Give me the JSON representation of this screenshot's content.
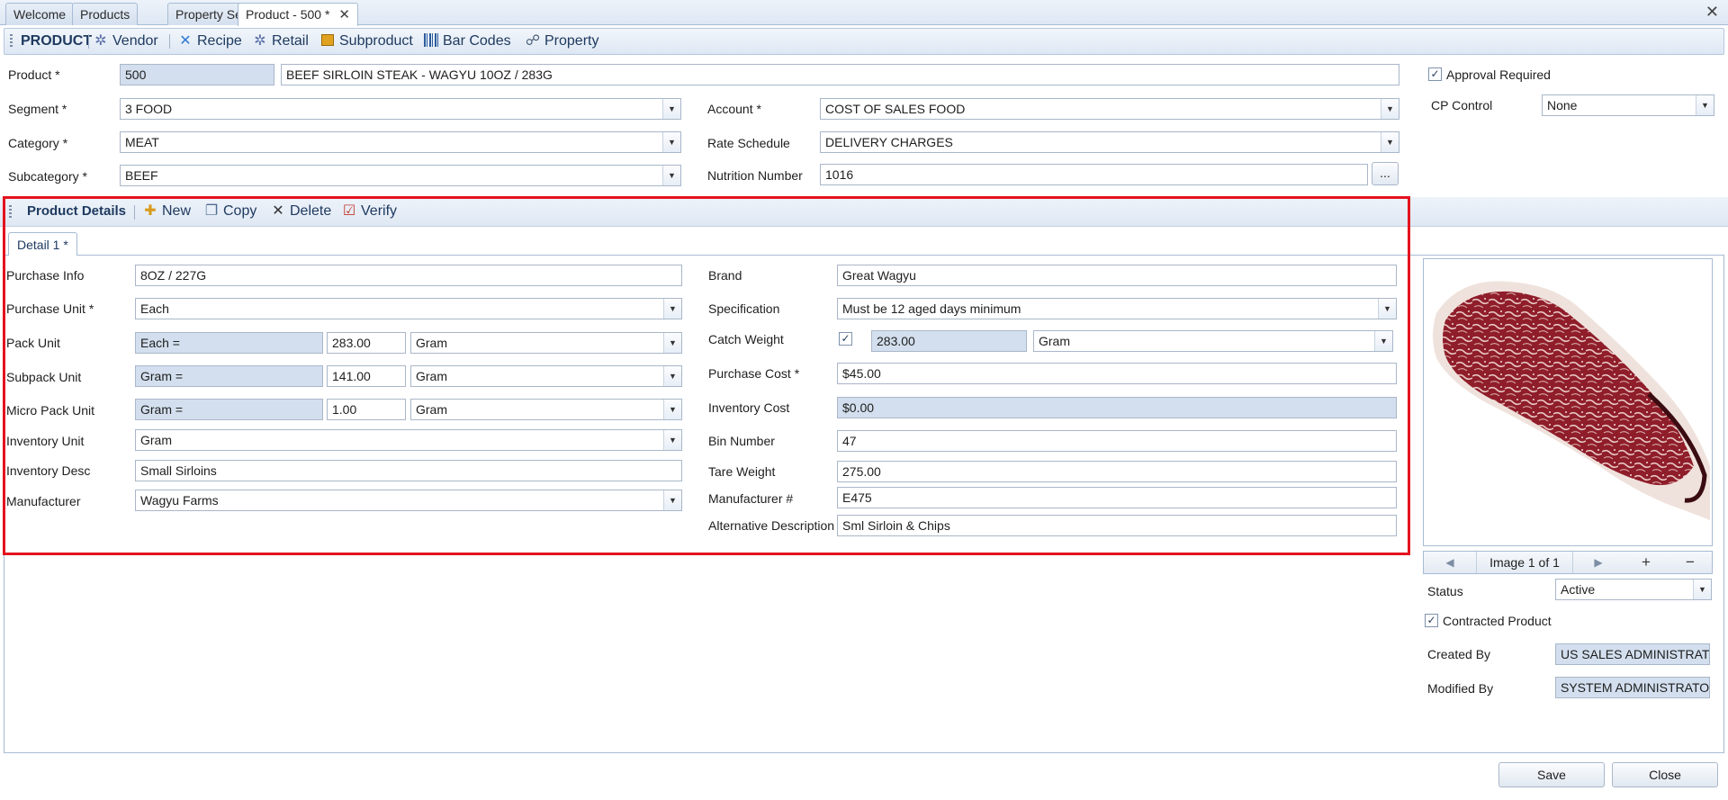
{
  "tabs": [
    {
      "label": "Welcome",
      "active": false
    },
    {
      "label": "Products",
      "active": false
    },
    {
      "label": "Property Setup",
      "active": false
    },
    {
      "label": "Product - 500 *",
      "active": true
    }
  ],
  "window_close": "✕",
  "toolbar": {
    "title": "PRODUCT",
    "vendor": "Vendor",
    "recipe": "Recipe",
    "retail": "Retail",
    "subproduct": "Subproduct",
    "barcodes": "Bar Codes",
    "property": "Property"
  },
  "header": {
    "product_label": "Product *",
    "product_code": "500",
    "product_name": "BEEF SIRLOIN STEAK - WAGYU 10OZ / 283G",
    "approval_label": "Approval Required",
    "approval_checked": true,
    "segment_label": "Segment *",
    "segment_value": "3 FOOD",
    "category_label": "Category *",
    "category_value": "MEAT",
    "subcategory_label": "Subcategory *",
    "subcategory_value": "BEEF",
    "account_label": "Account *",
    "account_value": "COST OF SALES FOOD",
    "rate_label": "Rate Schedule",
    "rate_value": "DELIVERY CHARGES",
    "nutrition_label": "Nutrition Number",
    "nutrition_value": "1016",
    "nutrition_btn": "...",
    "cp_label": "CP Control",
    "cp_value": "None"
  },
  "details_toolbar": {
    "title": "Product Details",
    "new": "New",
    "copy": "Copy",
    "delete": "Delete",
    "verify": "Verify"
  },
  "detail_tab": "Detail 1 *",
  "left_fields": {
    "purchase_info_label": "Purchase Info",
    "purchase_info_value": "8OZ / 227G",
    "purchase_unit_label": "Purchase Unit *",
    "purchase_unit_value": "Each",
    "pack_unit_label": "Pack Unit",
    "pack_unit_eq": "Each =",
    "pack_unit_qty": "283.00",
    "pack_unit_uom": "Gram",
    "subpack_label": "Subpack Unit",
    "subpack_eq": "Gram =",
    "subpack_qty": "141.00",
    "subpack_uom": "Gram",
    "micro_label": "Micro Pack Unit",
    "micro_eq": "Gram =",
    "micro_qty": "1.00",
    "micro_uom": "Gram",
    "inventory_unit_label": "Inventory Unit",
    "inventory_unit_value": "Gram",
    "inventory_desc_label": "Inventory Desc",
    "inventory_desc_value": "Small Sirloins",
    "manufacturer_label": "Manufacturer",
    "manufacturer_value": "Wagyu Farms"
  },
  "right_fields": {
    "brand_label": "Brand",
    "brand_value": "Great Wagyu",
    "spec_label": "Specification",
    "spec_value": "Must be 12 aged days minimum",
    "catch_label": "Catch Weight",
    "catch_checked": true,
    "catch_qty": "283.00",
    "catch_uom": "Gram",
    "purchase_cost_label": "Purchase Cost *",
    "purchase_cost_value": "$45.00",
    "inventory_cost_label": "Inventory Cost",
    "inventory_cost_value": "$0.00",
    "bin_label": "Bin Number",
    "bin_value": "47",
    "tare_label": "Tare Weight",
    "tare_value": "275.00",
    "mfr_num_label": "Manufacturer #",
    "mfr_num_value": "E475",
    "alt_desc_label": "Alternative Description",
    "alt_desc_value": "Sml Sirloin & Chips"
  },
  "image_panel": {
    "caption": "Image 1 of 1",
    "prev": "◀",
    "next": "▶",
    "add": "+",
    "remove": "−"
  },
  "side": {
    "status_label": "Status",
    "status_value": "Active",
    "contracted_label": "Contracted Product",
    "contracted_checked": true,
    "created_label": "Created By",
    "created_value": "US SALES ADMINISTRATOR",
    "modified_label": "Modified By",
    "modified_value": "SYSTEM ADMINISTRATOR"
  },
  "buttons": {
    "save": "Save",
    "close": "Close"
  },
  "colors": {
    "highlight": "#e3131e",
    "readonly_bg": "#d3dfee",
    "toolbar_text": "#1f3a60"
  },
  "icons": {
    "vendor": "gears-icon",
    "recipe": "cross-tools-icon",
    "retail": "gears-icon",
    "subproduct": "box-icon",
    "barcodes": "barcode-icon",
    "property": "org-chart-icon",
    "new": "new-document-icon",
    "copy": "copy-icon",
    "delete": "x-icon",
    "verify": "checklist-icon"
  }
}
